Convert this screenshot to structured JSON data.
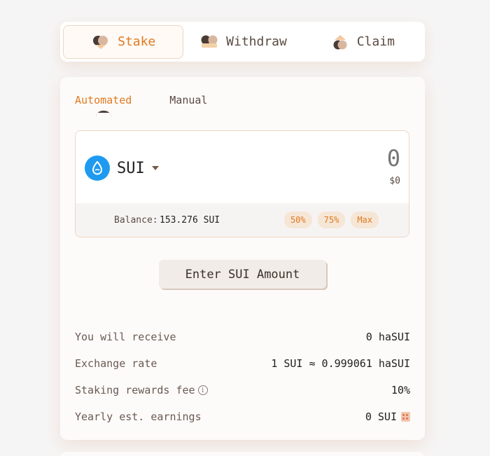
{
  "tabs": [
    {
      "label": "Stake",
      "icon": "stake-icon",
      "active": true
    },
    {
      "label": "Withdraw",
      "icon": "withdraw-icon",
      "active": false
    },
    {
      "label": "Claim",
      "icon": "claim-icon",
      "active": false
    }
  ],
  "modes": [
    {
      "label": "Automated",
      "active": true
    },
    {
      "label": "Manual",
      "active": false
    }
  ],
  "input": {
    "token": "SUI",
    "token_icon": "sui-icon",
    "amount_placeholder": "0",
    "usd_value": "$0",
    "balance_label": "Balance:",
    "balance_value": "153.276 SUI",
    "percent_buttons": [
      "50%",
      "75%",
      "Max"
    ]
  },
  "cta_label": "Enter SUI Amount",
  "info": {
    "rows": [
      {
        "label": "You will receive",
        "value": "0 haSUI"
      },
      {
        "label": "Exchange rate",
        "value": "1 SUI ≈ 0.999061 haSUI"
      },
      {
        "label": "Staking rewards fee",
        "value": "10%"
      },
      {
        "label": "Yearly est. earnings",
        "value": "0 SUI"
      }
    ],
    "info_icon": "i"
  },
  "colors": {
    "accent": "#e07a1f",
    "sui_blue": "#1e9bf0",
    "pill_bg": "#f6e6d6"
  }
}
